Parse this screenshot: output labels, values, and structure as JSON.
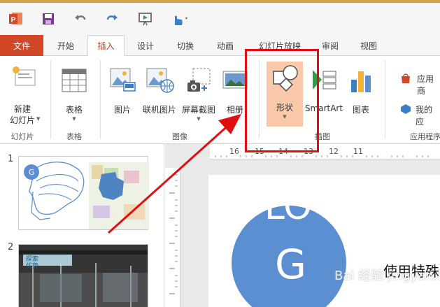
{
  "title_bar": {
    "app_icon": "powerpoint-icon",
    "buttons": [
      "save-icon",
      "undo-icon",
      "redo-icon",
      "present-icon",
      "touch-mode-icon"
    ]
  },
  "tabs": [
    "文件",
    "开始",
    "插入",
    "设计",
    "切换",
    "动画",
    "幻灯片放映",
    "审阅",
    "视图"
  ],
  "active_tab": "插入",
  "ribbon": {
    "new_slide": "新建\n幻灯片",
    "table": "表格",
    "picture": "图片",
    "online_picture": "联机图片",
    "screenshot": "屏幕截图",
    "album": "相册",
    "shapes": "形状",
    "smartart": "SmartArt",
    "chart": "图表",
    "apps_store": "应用商",
    "my_apps": "我的应",
    "groups": {
      "slides": "幻灯片",
      "tables": "表格",
      "images": "图像",
      "illustrations": "插图",
      "apps": "应用程序"
    }
  },
  "ruler": {
    "marks": [
      "16",
      "15",
      "14",
      "13",
      "12",
      "11"
    ]
  },
  "thumbnails": [
    {
      "number": "1"
    },
    {
      "number": "2",
      "caption": "探索\n优势"
    }
  ],
  "slide": {
    "logo_text": "LO",
    "logo_letter": "G",
    "body_text": "使用特殊"
  },
  "watermark": "Bai 经验 jingyan.baidu.com",
  "colors": {
    "file_tab": "#d24726",
    "accent": "#c43e1c",
    "shapes_highlight": "#f9c9a9",
    "annotation_red": "#e01010",
    "logo_blue": "#5b8fd1"
  }
}
